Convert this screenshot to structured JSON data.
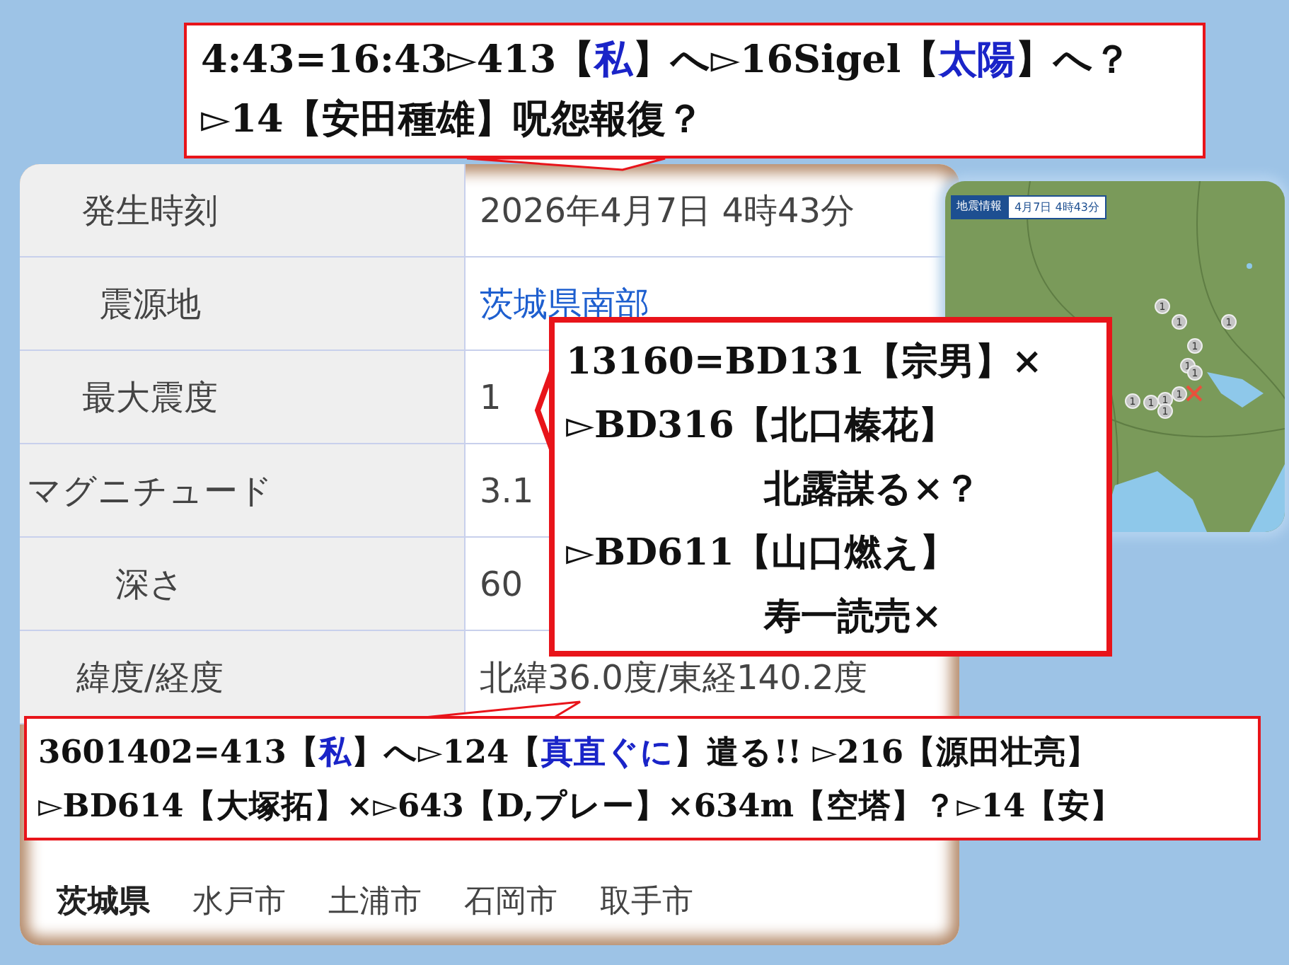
{
  "info_table": {
    "rows": [
      {
        "label": "発生時刻",
        "value": "2026年4月7日 4時43分",
        "link": false
      },
      {
        "label": "震源地",
        "value": "茨城県南部",
        "link": true
      },
      {
        "label": "最大震度",
        "value": "1",
        "link": false
      },
      {
        "label": "マグニチュード",
        "value": "3.1",
        "link": false
      },
      {
        "label": "深さ",
        "value": "60",
        "link": false
      },
      {
        "label": "緯度/経度",
        "value": "北緯36.0度/東経140.2度",
        "link": false
      }
    ],
    "region_tabs": [
      {
        "label": "茨城県",
        "selected": true
      },
      {
        "label": "水戸市",
        "selected": false
      },
      {
        "label": "土浦市",
        "selected": false
      },
      {
        "label": "石岡市",
        "selected": false
      },
      {
        "label": "取手市",
        "selected": false
      }
    ]
  },
  "map": {
    "header_title": "地震情報",
    "header_time": "4月7日 4時43分",
    "markers": [
      "1",
      "1",
      "1",
      "1",
      "1",
      "1",
      "1",
      "1",
      "1",
      "1",
      "1"
    ]
  },
  "callouts": [
    {
      "lines": [
        [
          {
            "text": "4:43=16:43▻413【",
            "highlight": false
          },
          {
            "text": "私",
            "highlight": true
          },
          {
            "text": "】へ▻16Sigel【",
            "highlight": false
          },
          {
            "text": "太陽",
            "highlight": true
          },
          {
            "text": "】へ？",
            "highlight": false
          }
        ],
        [
          {
            "text": "▻14【安田種雄】呪怨報復？",
            "highlight": false
          }
        ]
      ]
    },
    {
      "lines": [
        [
          {
            "text": "13160=BD131【宗男】×",
            "highlight": false
          }
        ],
        [
          {
            "text": "▻BD316【北口榛花】",
            "highlight": false
          }
        ],
        [
          {
            "text": "北露謀る×？",
            "highlight": false
          }
        ],
        [
          {
            "text": "▻BD611【山口燃え】",
            "highlight": false
          }
        ],
        [
          {
            "text": "寿一読売×",
            "highlight": false
          }
        ]
      ]
    },
    {
      "lines": [
        [
          {
            "text": "3601402=413【",
            "highlight": false
          },
          {
            "text": "私",
            "highlight": true
          },
          {
            "text": "】へ▻124【",
            "highlight": false
          },
          {
            "text": "真直ぐに",
            "highlight": true
          },
          {
            "text": "】遣る!! ▻216【源田壮亮】",
            "highlight": false
          }
        ],
        [
          {
            "text": "▻BD614【大塚拓】×▻643【D,プレー】×634m【空塔】？▻14【安】",
            "highlight": false
          }
        ]
      ]
    }
  ]
}
